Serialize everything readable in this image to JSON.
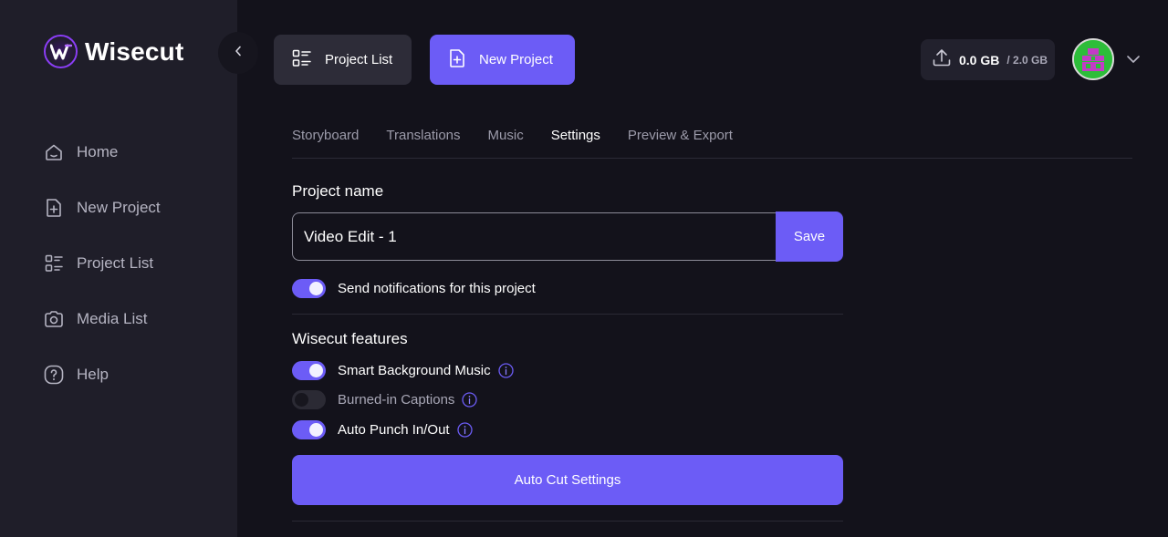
{
  "brand": {
    "name": "Wisecut",
    "accent": "#6c5cf6"
  },
  "sidebar": {
    "items": [
      {
        "label": "Home",
        "icon": "home-icon"
      },
      {
        "label": "New Project",
        "icon": "file-plus-icon"
      },
      {
        "label": "Project List",
        "icon": "list-icon"
      },
      {
        "label": "Media List",
        "icon": "camera-icon"
      },
      {
        "label": "Help",
        "icon": "help-icon"
      }
    ]
  },
  "header": {
    "project_list_label": "Project List",
    "new_project_label": "New Project",
    "storage_used": "0.0 GB",
    "storage_total": "/ 2.0 GB"
  },
  "tabs": [
    {
      "label": "Storyboard",
      "active": false
    },
    {
      "label": "Translations",
      "active": false
    },
    {
      "label": "Music",
      "active": false
    },
    {
      "label": "Settings",
      "active": true
    },
    {
      "label": "Preview & Export",
      "active": false
    }
  ],
  "settings": {
    "project_name_title": "Project name",
    "project_name_value": "Video Edit - 1",
    "save_label": "Save",
    "notifications_label": "Send notifications for this project",
    "notifications_on": true,
    "features_title": "Wisecut features",
    "features": [
      {
        "label": "Smart Background Music",
        "on": true
      },
      {
        "label": "Burned-in Captions",
        "on": false
      },
      {
        "label": "Auto Punch In/Out",
        "on": true
      }
    ],
    "auto_cut_label": "Auto Cut Settings"
  }
}
